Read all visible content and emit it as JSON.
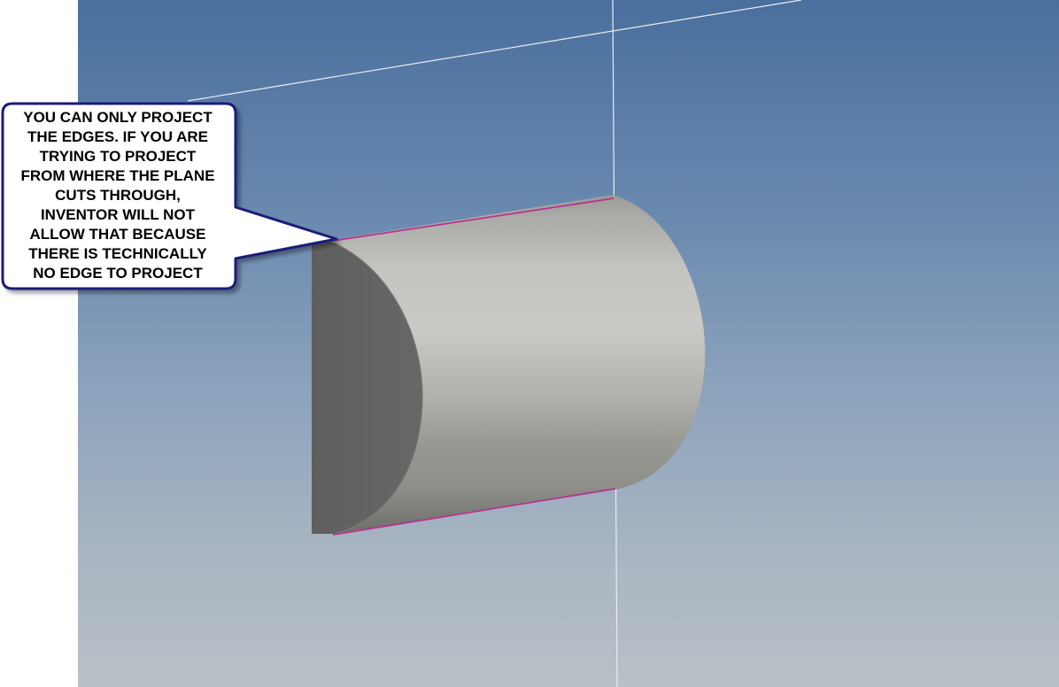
{
  "viewport": {
    "background_top": "#4a6f9e",
    "background_bottom": "#b9c0c7"
  },
  "model": {
    "shape": "half-cylinder",
    "face_color": "#646464",
    "body_color": "#bdbdb8",
    "projected_edge_color": "#b8338f",
    "plane_line_color": "#e8ecf0"
  },
  "callout": {
    "text": "YOU CAN ONLY PROJECT\nTHE EDGES.  IF YOU ARE\nTRYING TO PROJECT\nFROM WHERE THE PLANE\nCUTS THROUGH,\nINVENTOR WILL NOT\nALLOW THAT BECAUSE\nTHERE IS TECHNICALLY\nNO EDGE TO PROJECT",
    "border_color": "#1e1e7a",
    "fill_color": "#ffffff"
  }
}
